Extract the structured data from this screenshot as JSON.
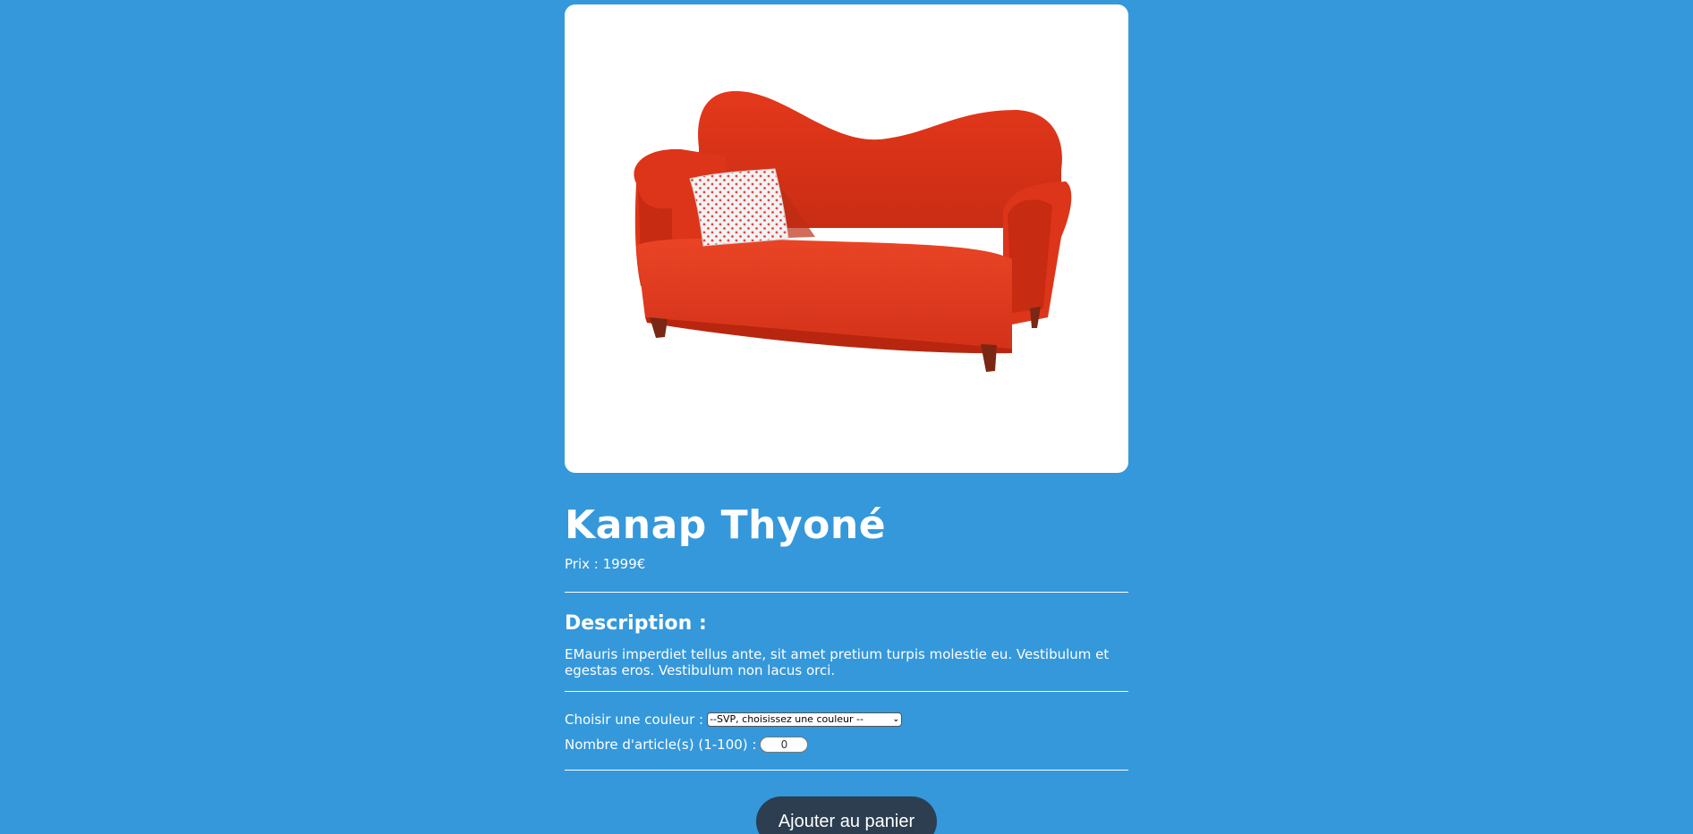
{
  "product": {
    "title": "Kanap Thyoné",
    "price_label": "Prix : ",
    "price_value": "1999",
    "currency": "€",
    "image_alt": "red sofa with white heart-pattern cushion",
    "description_heading": "Description :",
    "description_text": "EMauris imperdiet tellus ante, sit amet pretium turpis molestie eu. Vestibulum et egestas eros. Vestibulum non lacus orci."
  },
  "options": {
    "color_label": "Choisir une couleur : ",
    "color_selected": "--SVP, choisissez une couleur --",
    "quantity_label": "Nombre d'article(s) (1-100) : ",
    "quantity_value": "0"
  },
  "cart": {
    "button_label": "Ajouter au panier"
  },
  "colors": {
    "background": "#3498db",
    "button": "#2c3e50",
    "sofa": "#e03a1e"
  }
}
